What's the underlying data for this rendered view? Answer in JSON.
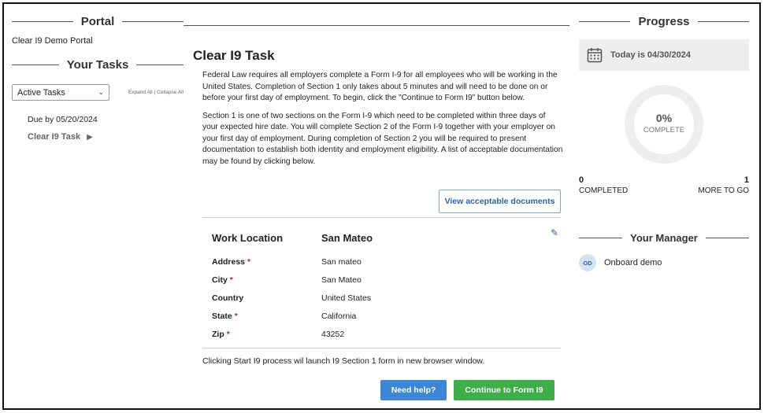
{
  "left": {
    "portal_header": "Portal",
    "portal_name": "Clear I9 Demo Portal",
    "tasks_header": "Your Tasks",
    "filter_selected": "Active Tasks",
    "expand_all": "Expand All",
    "collapse_all": "Collapse All",
    "separator": "|",
    "due_date": "Due by 05/20/2024",
    "task_name": "Clear I9 Task"
  },
  "main": {
    "title": "Clear I9 Task",
    "para1": "Federal Law requires all employers complete a Form I-9 for all employees who will be working in the United States. Completion of Section 1 only takes about 5 minutes and will need to be done on or before your first day of employment. To begin, click the \"Continue to Form I9\" button below.",
    "para2": "Section 1 is one of two sections on the Form I-9 which need to be completed within three days of your expected hire date. You will complete Section 2 of the Form I-9 together with your employer on your first day of employment. During completion of Section 2 you will be required to present documentation to establish both identity and employment eligibility. A list of acceptable documentation may be found by clicking below.",
    "view_docs_label": "View acceptable documents",
    "work_location": {
      "label": "Work Location",
      "value": "San Mateo",
      "rows": [
        {
          "label": "Address",
          "required": "*",
          "value": "San mateo"
        },
        {
          "label": "City",
          "required": "*",
          "value": "San Mateo"
        },
        {
          "label": "Country",
          "required": "",
          "value": "United States"
        },
        {
          "label": "State",
          "required": "*",
          "value": "California"
        },
        {
          "label": "Zip",
          "required": "*",
          "value": "43252"
        }
      ]
    },
    "launch_note": "Clicking Start I9 process wil launch I9 Section 1 form in new browser window.",
    "help_label": "Need help?",
    "continue_label": "Continue to Form I9"
  },
  "right": {
    "progress_header": "Progress",
    "today": "Today is 04/30/2024",
    "percent": "0%",
    "complete_label": "COMPLETE",
    "completed_count": "0",
    "completed_label": "COMPLETED",
    "remaining_count": "1",
    "remaining_label": "MORE TO GO",
    "manager_header": "Your Manager",
    "manager_initials": "OD",
    "manager_name": "Onboard demo"
  },
  "icons": {
    "calendar": "calendar-icon",
    "pencil": "pencil-icon",
    "play": "play-icon",
    "chevron": "chevron-down-icon"
  }
}
